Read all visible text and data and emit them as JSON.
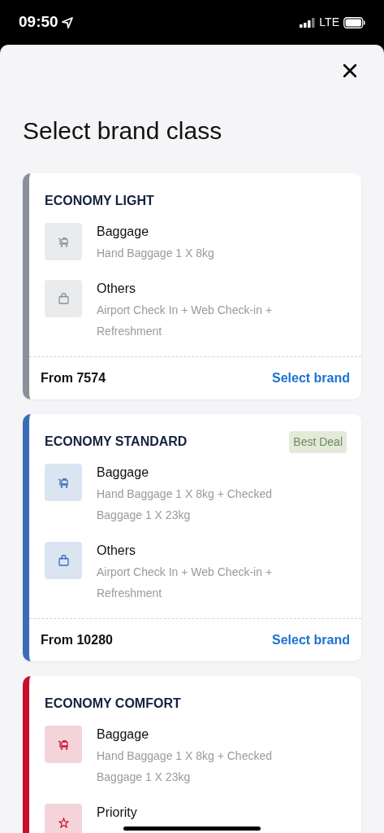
{
  "status_bar": {
    "time": "09:50",
    "network": "LTE"
  },
  "title": "Select brand class",
  "brands": [
    {
      "name": "ECONOMY LIGHT",
      "color": "#8a9099",
      "features": [
        {
          "kind": "baggage",
          "title": "Baggage",
          "detail": "Hand Baggage 1 X 8kg"
        },
        {
          "kind": "others",
          "title": "Others",
          "detail": "Airport Check In + Web Check-in + Refreshment"
        }
      ],
      "price": "From 7574",
      "action": "Select brand"
    },
    {
      "name": "ECONOMY STANDARD",
      "color": "#3a6db5",
      "badge": "Best Deal",
      "features": [
        {
          "kind": "baggage",
          "title": "Baggage",
          "detail": "Hand Baggage 1 X 8kg + Checked Baggage 1 X 23kg"
        },
        {
          "kind": "others",
          "title": "Others",
          "detail": "Airport Check In + Web Check-in + Refreshment"
        }
      ],
      "price": "From 10280",
      "action": "Select brand"
    },
    {
      "name": "ECONOMY COMFORT",
      "color": "#c8102e",
      "features": [
        {
          "kind": "baggage",
          "title": "Baggage",
          "detail": "Hand Baggage 1 X 8kg + Checked Baggage 1 X 23kg"
        },
        {
          "kind": "priority",
          "title": "Priority"
        }
      ]
    }
  ]
}
